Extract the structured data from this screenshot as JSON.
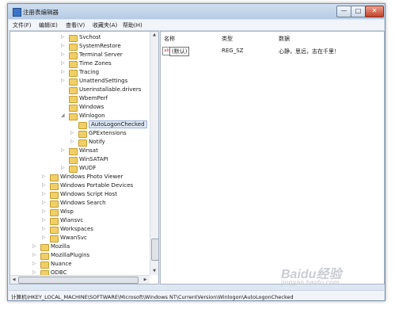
{
  "window": {
    "title": "注册表编辑器",
    "min_label": "—",
    "max_label": "□",
    "close_label": "✕"
  },
  "menu": [
    "文件(F)",
    "编辑(E)",
    "查看(V)",
    "收藏夹(A)",
    "帮助(H)"
  ],
  "tree": [
    {
      "label": "Svchost",
      "arrow": "▷",
      "level": 3
    },
    {
      "label": "SystemRestore",
      "arrow": "▷",
      "level": 3
    },
    {
      "label": "Terminal Server",
      "arrow": "▷",
      "level": 3
    },
    {
      "label": "Time Zones",
      "arrow": "▷",
      "level": 3
    },
    {
      "label": "Tracing",
      "arrow": "▷",
      "level": 3
    },
    {
      "label": "UnattendSettings",
      "arrow": "▷",
      "level": 3
    },
    {
      "label": "Userinstallable.drivers",
      "arrow": "",
      "level": 3
    },
    {
      "label": "WbemPerf",
      "arrow": "",
      "level": 3
    },
    {
      "label": "Windows",
      "arrow": "",
      "level": 3
    },
    {
      "label": "Winlogon",
      "arrow": "◢",
      "level": 3
    },
    {
      "label": "AutoLogonChecked",
      "arrow": "",
      "level": 4,
      "selected": true
    },
    {
      "label": "GPExtensions",
      "arrow": "▷",
      "level": 4
    },
    {
      "label": "Notify",
      "arrow": "▷",
      "level": 4
    },
    {
      "label": "Winsat",
      "arrow": "▷",
      "level": 3
    },
    {
      "label": "WinSATAPI",
      "arrow": "",
      "level": 3
    },
    {
      "label": "WUDF",
      "arrow": "▷",
      "level": 3
    },
    {
      "label": "Windows Photo Viewer",
      "arrow": "▷",
      "level": 1
    },
    {
      "label": "Windows Portable Devices",
      "arrow": "▷",
      "level": 1
    },
    {
      "label": "Windows Script Host",
      "arrow": "▷",
      "level": 1
    },
    {
      "label": "Windows Search",
      "arrow": "▷",
      "level": 1
    },
    {
      "label": "Wisp",
      "arrow": "▷",
      "level": 1
    },
    {
      "label": "Wlansvc",
      "arrow": "▷",
      "level": 1
    },
    {
      "label": "Workspaces",
      "arrow": "▷",
      "level": 1
    },
    {
      "label": "WwanSvc",
      "arrow": "▷",
      "level": 1
    },
    {
      "label": "Mozilla",
      "arrow": "▷",
      "level": 0
    },
    {
      "label": "MozillaPlugins",
      "arrow": "▷",
      "level": 0
    },
    {
      "label": "Nuance",
      "arrow": "▷",
      "level": 0
    },
    {
      "label": "ODBC",
      "arrow": "▷",
      "level": 0
    }
  ],
  "list": {
    "headers": {
      "name": "名称",
      "type": "类型",
      "data": "数据"
    },
    "rows": [
      {
        "icon": "ab",
        "name": "(默认)",
        "type": "REG_SZ",
        "data": "心静，思远，志在千里！"
      }
    ]
  },
  "scroll": {
    "up": "▲",
    "down": "▼",
    "left": "◀",
    "right": "▶"
  },
  "status": "计算机\\HKEY_LOCAL_MACHINE\\SOFTWARE\\Microsoft\\Windows NT\\CurrentVersion\\Winlogon\\AutoLogonChecked",
  "watermark": {
    "brand": "Baidu经验",
    "url": "jingyan.baidu.com"
  }
}
